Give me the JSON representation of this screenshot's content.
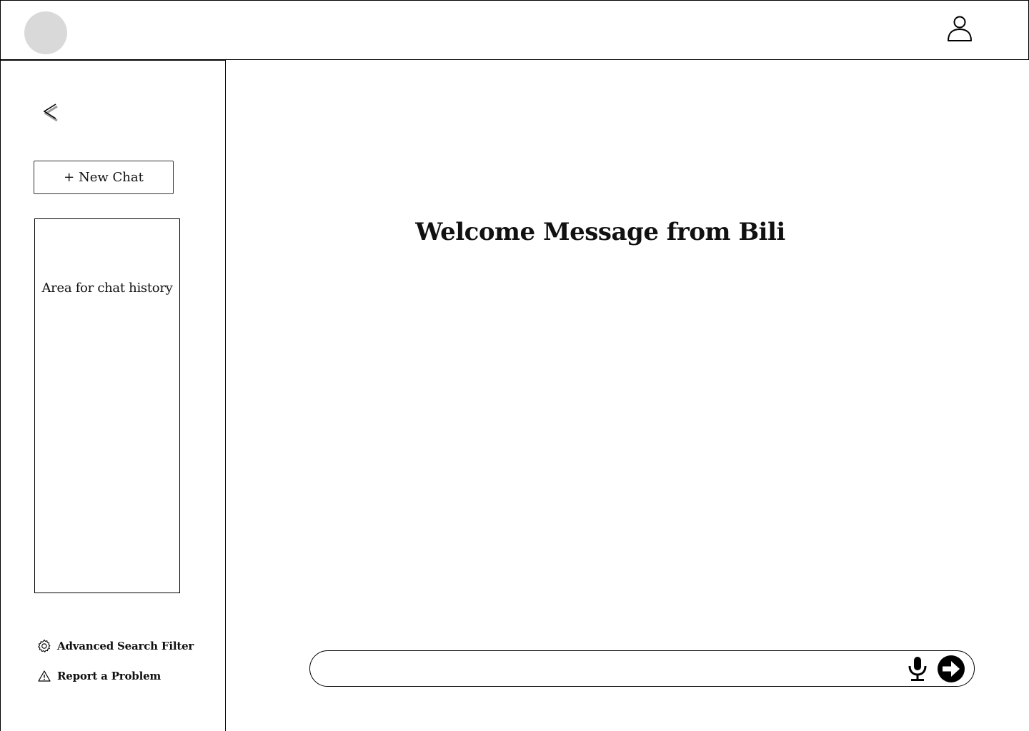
{
  "header": {
    "logo_icon": "logo-circle",
    "user_icon": "user-icon"
  },
  "sidebar": {
    "collapse_icon": "chevron-left-icon",
    "new_chat_label": "+ New Chat",
    "history_placeholder": "Area for chat history",
    "links": [
      {
        "icon": "gear-icon",
        "label": "Advanced Search Filter"
      },
      {
        "icon": "warning-icon",
        "label": "Report a Problem"
      }
    ]
  },
  "main": {
    "welcome": "Welcome Message from Bili",
    "chat_input": {
      "value": "",
      "placeholder": ""
    },
    "mic_icon": "microphone-icon",
    "send_icon": "arrow-right-circle-icon"
  },
  "colors": {
    "logo_fill": "#d9d9d9",
    "border": "#000000",
    "background": "#ffffff"
  }
}
